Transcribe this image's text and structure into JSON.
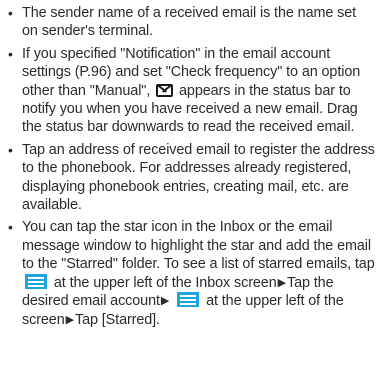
{
  "bullets": [
    {
      "text": "The sender name of a received email is the name set on sender's terminal."
    },
    {
      "part1": "If you specified \"Notification\" in the email account settings (P.96) and set \"Check frequency\" to an option other than \"Manual\",",
      "icon": "envelope-icon",
      "part2": "appears in the status bar to notify you when you have received a new email. Drag the status bar downwards to read the received email."
    },
    {
      "text": "Tap an address of received email to register the address to the phonebook. For addresses already registered, displaying phonebook entries, creating mail, etc. are available."
    },
    {
      "part1": "You can tap the star icon in the Inbox or the email message window to highlight the star and add the email to the \"Starred\" folder. To see a list of starred emails, tap",
      "icon1": "menu-icon",
      "part2": "at the upper left of the Inbox screen",
      "arrow": "▶",
      "part3": "Tap the desired email account",
      "icon2": "menu-icon",
      "part4": "at the upper left of the screen",
      "part5": "Tap [Starred]."
    }
  ],
  "bullet_symbol": "•",
  "colors": {
    "text": "#2b2b2b",
    "menu_icon": "#1fa4e0"
  }
}
